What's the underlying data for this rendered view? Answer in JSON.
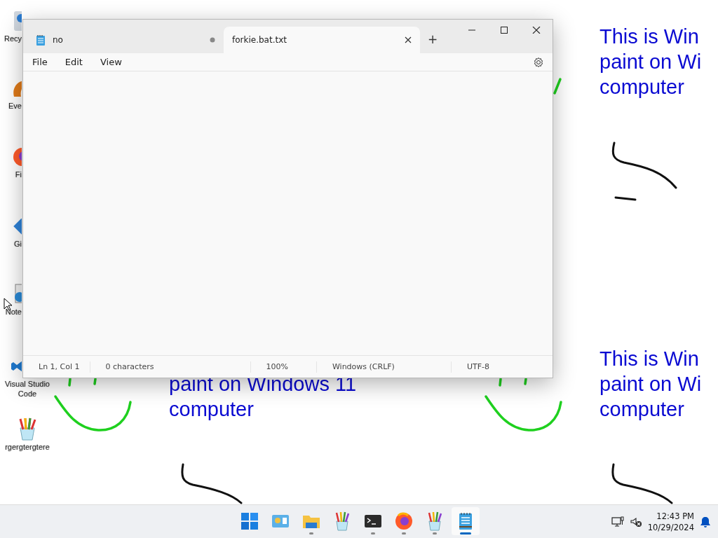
{
  "desktop": {
    "icons": [
      {
        "kind": "bin",
        "label": "Recy"
      },
      {
        "kind": "app",
        "label": "Eve"
      },
      {
        "kind": "firefox",
        "label": "Fi"
      },
      {
        "kind": "git",
        "label": "Gi"
      },
      {
        "kind": "note",
        "label": "Note"
      },
      {
        "kind": "vscode",
        "label": "Visual Studio Code"
      },
      {
        "kind": "brushes",
        "label": "rgergtergtere"
      }
    ],
    "wallpaper_texts": [
      {
        "lines": [
          "This is Win",
          "paint on Wi",
          "computer"
        ]
      },
      {
        "lines": [
          "paint on Windows 11",
          "computer"
        ]
      },
      {
        "lines": [
          "This is Win",
          "paint on Wi",
          "computer"
        ]
      }
    ]
  },
  "window": {
    "tabs": [
      {
        "label": "no",
        "selected": false,
        "modified": true
      },
      {
        "label": "forkie.bat.txt",
        "selected": true,
        "modified": false
      }
    ],
    "new_tab": "+",
    "menu": [
      "File",
      "Edit",
      "View"
    ],
    "status_bar": [
      "Ln 1, Col 1",
      "0 characters",
      "100%",
      "Windows (CRLF)",
      "UTF-8"
    ]
  },
  "taskbar": {
    "apps": [
      {
        "kind": "start",
        "running": false,
        "active": false
      },
      {
        "kind": "control",
        "running": false,
        "active": false
      },
      {
        "kind": "folder",
        "running": true,
        "active": false
      },
      {
        "kind": "brushes",
        "running": false,
        "active": false
      },
      {
        "kind": "terminal",
        "running": true,
        "active": false
      },
      {
        "kind": "firefox",
        "running": true,
        "active": false
      },
      {
        "kind": "brushes",
        "running": true,
        "active": false
      },
      {
        "kind": "notepad",
        "running": true,
        "active": true
      }
    ],
    "clock": {
      "time": "12:43 PM",
      "date": "10/29/2024"
    }
  }
}
